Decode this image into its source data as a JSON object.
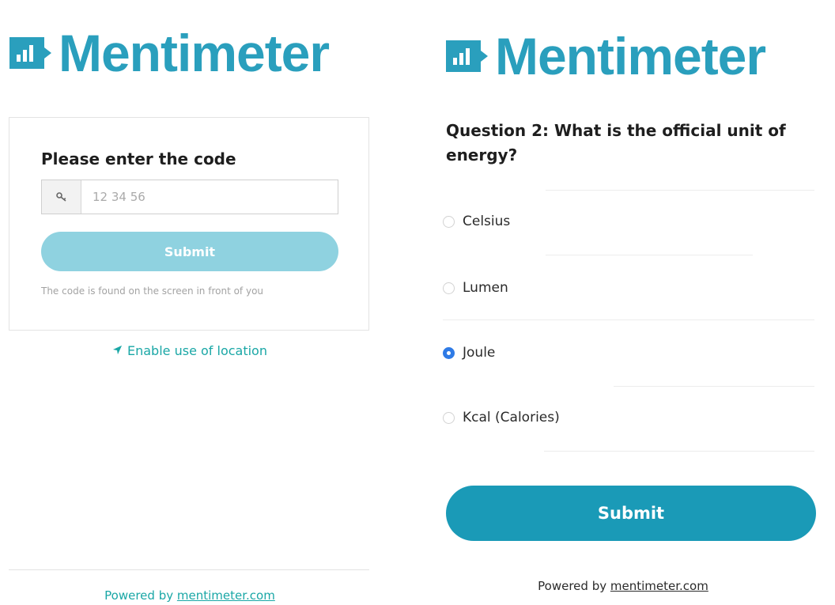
{
  "brand": {
    "name": "Mentimeter",
    "color": "#2a9fbd"
  },
  "left": {
    "card_title": "Please enter the code",
    "code_placeholder": "12 34 56",
    "submit_label": "Submit",
    "hint": "The code is found on the screen in front of you",
    "location_link": "Enable use of location",
    "powered_prefix": "Powered by ",
    "powered_link": "mentimeter.com"
  },
  "right": {
    "question": "Question 2: What is the official unit of energy?",
    "options": [
      {
        "label": "Celsius",
        "checked": false
      },
      {
        "label": "Lumen",
        "checked": false
      },
      {
        "label": "Joule",
        "checked": true
      },
      {
        "label": "Kcal (Calories)",
        "checked": false
      }
    ],
    "submit_label": "Submit",
    "powered_prefix": "Powered by ",
    "powered_link": "mentimeter.com"
  },
  "icons": {
    "logo": "bar-chart-logo-icon",
    "code_input": "key-icon",
    "location": "location-arrow-icon"
  }
}
